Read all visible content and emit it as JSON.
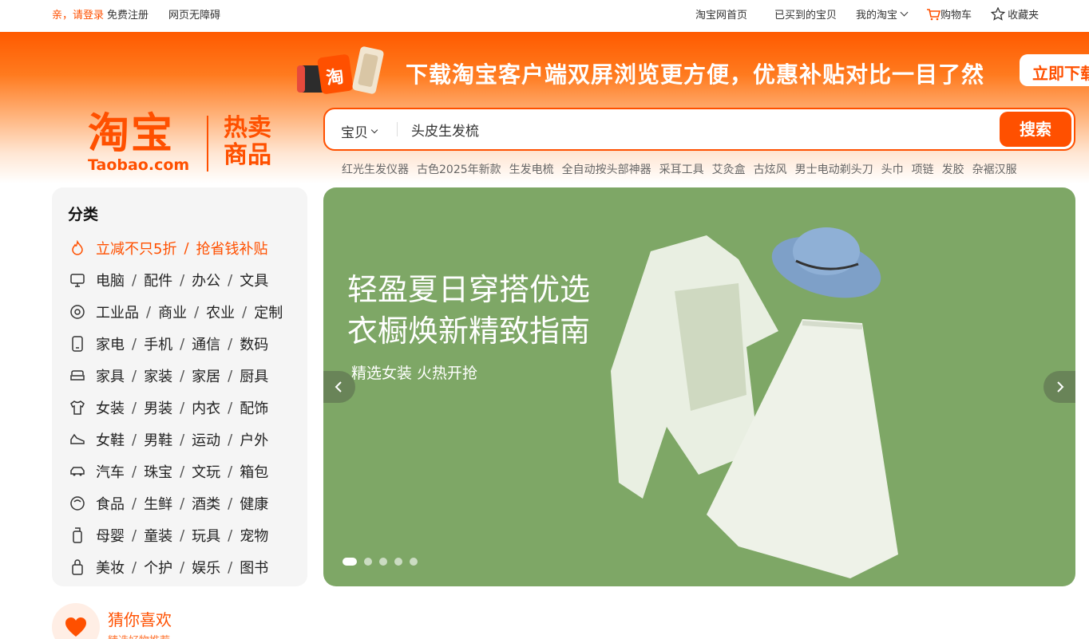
{
  "topbar": {
    "login": "亲，请登录",
    "register": "免费注册",
    "accessibility": "网页无障碍",
    "home": "淘宝网首页",
    "bought": "已买到的宝贝",
    "my_taobao": "我的淘宝",
    "cart": "购物车",
    "favorites": "收藏夹"
  },
  "promo": {
    "text": "下载淘宝客户端双屏浏览更方便，优惠补贴对比一目了然",
    "button": "立即下载"
  },
  "logo": {
    "cn": "淘宝",
    "en": "Taobao.com",
    "hot_line1": "热卖",
    "hot_line2": "商品"
  },
  "search": {
    "category": "宝贝",
    "query": "头皮生发梳",
    "button": "搜索"
  },
  "hotwords": [
    "红光生发仪器",
    "古色2025年新款",
    "生发电梳",
    "全自动按头部神器",
    "采耳工具",
    "艾灸盒",
    "古炫风",
    "男士电动剃头刀",
    "头巾",
    "项链",
    "发胶",
    "杂裾汉服"
  ],
  "sidebar": {
    "title": "分类",
    "rows": [
      {
        "icon": "flame-icon",
        "items": [
          "立减不只5折",
          "抢省钱补贴"
        ]
      },
      {
        "icon": "monitor-icon",
        "items": [
          "电脑",
          "配件",
          "办公",
          "文具"
        ]
      },
      {
        "icon": "target-icon",
        "items": [
          "工业品",
          "商业",
          "农业",
          "定制"
        ]
      },
      {
        "icon": "phone-icon",
        "items": [
          "家电",
          "手机",
          "通信",
          "数码"
        ]
      },
      {
        "icon": "sofa-icon",
        "items": [
          "家具",
          "家装",
          "家居",
          "厨具"
        ]
      },
      {
        "icon": "shirt-icon",
        "items": [
          "女装",
          "男装",
          "内衣",
          "配饰"
        ]
      },
      {
        "icon": "shoe-icon",
        "items": [
          "女鞋",
          "男鞋",
          "运动",
          "户外"
        ]
      },
      {
        "icon": "car-icon",
        "items": [
          "汽车",
          "珠宝",
          "文玩",
          "箱包"
        ]
      },
      {
        "icon": "food-icon",
        "items": [
          "食品",
          "生鲜",
          "酒类",
          "健康"
        ]
      },
      {
        "icon": "bottle-icon",
        "items": [
          "母婴",
          "童装",
          "玩具",
          "宠物"
        ]
      },
      {
        "icon": "bag-icon",
        "items": [
          "美妆",
          "个护",
          "娱乐",
          "图书"
        ]
      }
    ]
  },
  "banner": {
    "line1": "轻盈夏日穿搭优选",
    "line2": "衣橱焕新精致指南",
    "sub": "精选女装 火热开抢",
    "slides": 5,
    "active_slide": 1,
    "bg_color": "#7ea766"
  },
  "guess": {
    "title": "猜你喜欢",
    "sub": "精选好物推荐"
  },
  "colors": {
    "accent": "#ff5000"
  }
}
